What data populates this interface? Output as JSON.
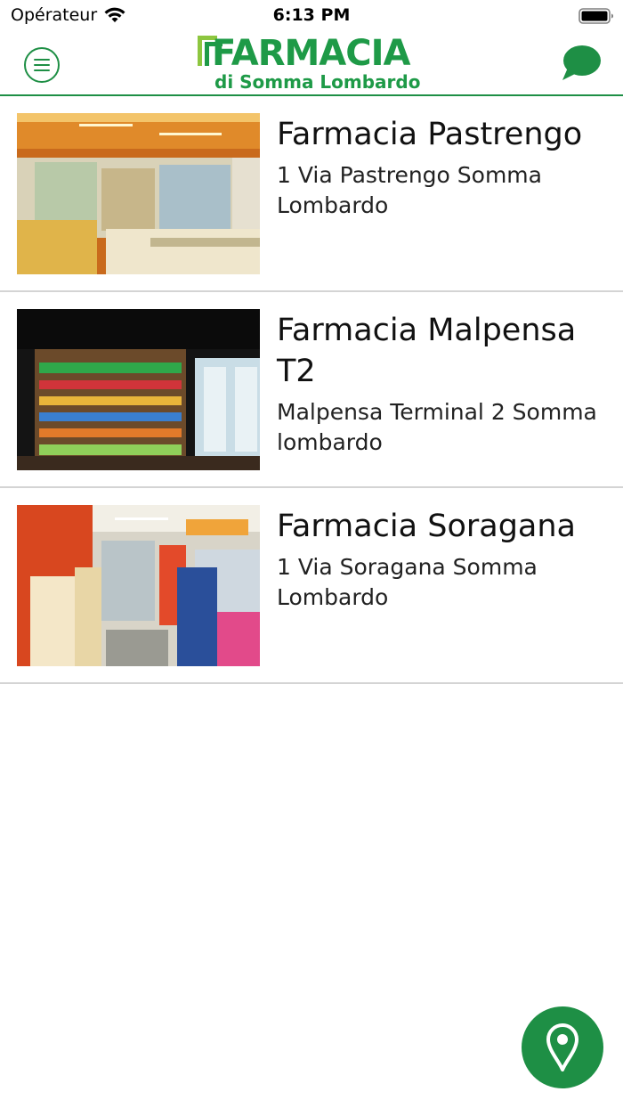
{
  "status_bar": {
    "carrier": "Opérateur",
    "time": "6:13 PM",
    "icons": [
      "wifi-icon",
      "battery-icon"
    ]
  },
  "header": {
    "menu_icon": "hamburger-menu-icon",
    "logo_title": "FARMACIA",
    "logo_subtitle": "di Somma Lombardo",
    "chat_icon": "chat-bubble-icon",
    "accent_color": "#1e8f45"
  },
  "pharmacies": [
    {
      "name": "Farmacia Pastrengo",
      "address": "1 Via Pastrengo Somma Lombardo",
      "image": "pharmacy-interior-photo"
    },
    {
      "name": "Farmacia Malpensa T2",
      "address": "Malpensa Terminal 2  Somma lombardo",
      "image": "pharmacy-interior-photo"
    },
    {
      "name": "Farmacia Soragana",
      "address": "1 Via Soragana Somma Lombardo",
      "image": "pharmacy-interior-photo"
    }
  ],
  "fab": {
    "icon": "map-pin-icon"
  }
}
